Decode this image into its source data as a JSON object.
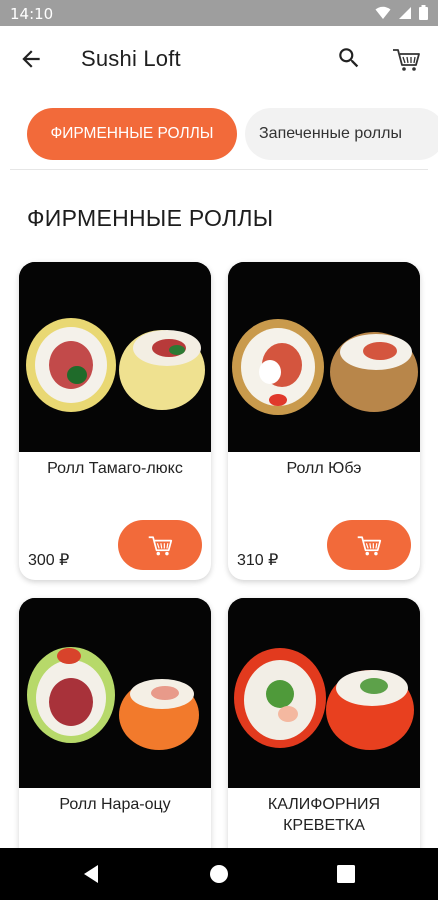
{
  "status_bar": {
    "time": "14:10"
  },
  "app_bar": {
    "title": "Sushi Loft"
  },
  "tabs": [
    {
      "label": "ФИРМЕННЫЕ РОЛЛЫ",
      "active": true
    },
    {
      "label": "Запеченные роллы",
      "active": false
    }
  ],
  "section": {
    "title": "ФИРМЕННЫЕ РОЛЛЫ"
  },
  "products": [
    {
      "name": "Ролл Тамаго-люкс",
      "price": "300 ₽"
    },
    {
      "name": "Ролл Юбэ",
      "price": "310 ₽"
    },
    {
      "name": "Ролл Нара-оцу",
      "price": ""
    },
    {
      "name": "КАЛИФОРНИЯ КРЕВЕТКА",
      "price": ""
    }
  ],
  "colors": {
    "accent": "#f26a3a",
    "status_bar": "#9e9e9e",
    "nav_bar": "#000000"
  }
}
